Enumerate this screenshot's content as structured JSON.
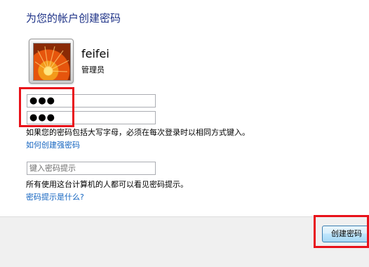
{
  "page": {
    "title": "为您的帐户创建密码"
  },
  "user": {
    "name": "feifei",
    "role": "管理员",
    "avatar_icon": "orange-flower-picture"
  },
  "form": {
    "password_value": "●●●",
    "confirm_value": "●●●",
    "case_note": "如果您的密码包括大写字母，必须在每次登录时以相同方式键入。",
    "strong_password_link": "如何创建强密码",
    "hint_placeholder": "键入密码提示",
    "hint_note": "所有使用这台计算机的人都可以看见密码提示。",
    "hint_help_link": "密码提示是什么?"
  },
  "footer": {
    "create_button": "创建密码"
  },
  "colors": {
    "title": "#1e3287",
    "link": "#1565c0",
    "highlight": "#e8121a"
  }
}
